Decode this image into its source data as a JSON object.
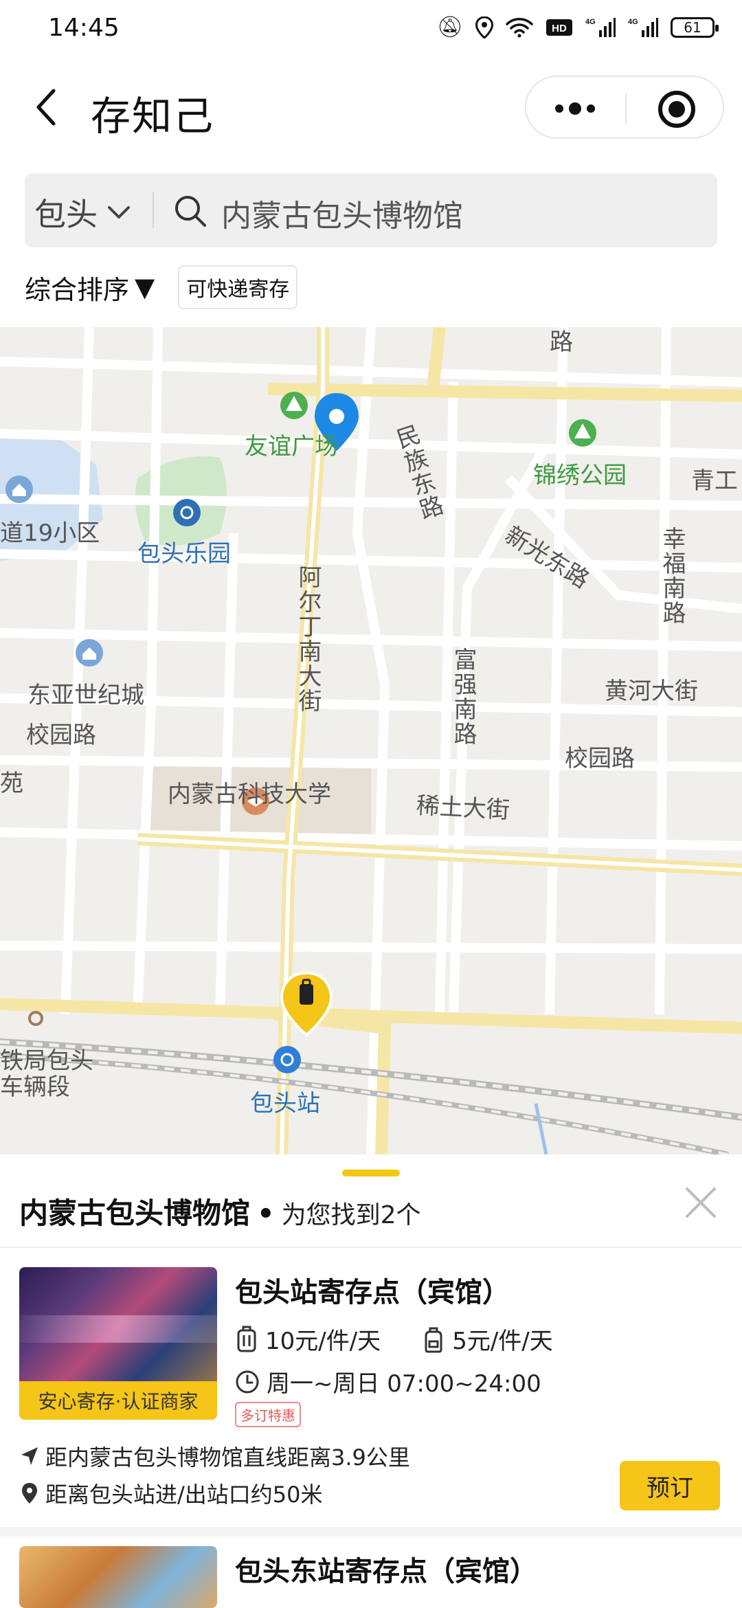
{
  "status_bar": {
    "time": "14:45",
    "battery": "61"
  },
  "header": {
    "title": "存知己"
  },
  "search": {
    "city": "包头",
    "query": "内蒙古包头博物馆"
  },
  "filters": {
    "sort_label": "综合排序",
    "sort_arrow": "▼",
    "chip_label": "可快递寄存"
  },
  "map": {
    "labels": {
      "youyi": "友谊广场",
      "minzu": "民族东路",
      "jinxiu": "锦绣公园",
      "qinggong": "青工",
      "xiaoqu": "道19小区",
      "xinguang": "新光东路",
      "xingfu": "幸福南路",
      "leyuan": "包头乐园",
      "aerding": "阿尔丁南大街",
      "dongya": "东亚世纪城",
      "fuqiang": "富强南路",
      "huanghe": "黄河大街",
      "xiaoyuan_left": "校园路",
      "xiaoyuan_right": "校园路",
      "yuan": "苑",
      "keji": "内蒙古科技大学",
      "xitu": "稀土大街",
      "tieju": "铁局包头",
      "cheliang": "车辆段",
      "station": "包头站",
      "top_lu": "路"
    },
    "colors": {
      "road_major": "#f5e6a6",
      "pin_blue": "#1e88e5",
      "pin_yellow": "#f5c518",
      "park": "#cfe8c9",
      "water": "#cfe0f2"
    }
  },
  "results": {
    "destination": "内蒙古包头博物馆",
    "bullet": "•",
    "found_text": "为您找到2个",
    "items": [
      {
        "title": "包头站寄存点（宾馆）",
        "price_luggage": "10元/件/天",
        "price_bag": "5元/件/天",
        "hours": "周一~周日 07:00~24:00",
        "promo": "多订特惠",
        "badge": "安心寄存·认证商家",
        "distance": "距内蒙古包头博物馆直线距离3.9公里",
        "station_distance": "距离包头站进/出站口约50米",
        "book_label": "预订"
      },
      {
        "title": "包头东站寄存点（宾馆）"
      }
    ]
  }
}
